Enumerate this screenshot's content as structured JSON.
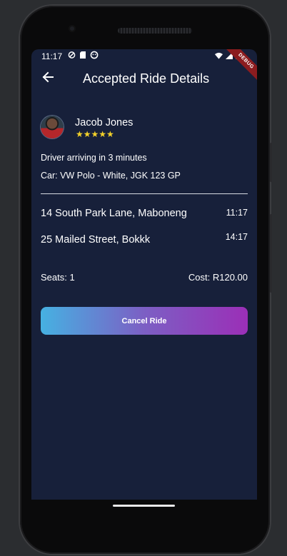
{
  "status_bar": {
    "time": "11:17"
  },
  "debug_banner": "DEBUG",
  "app_bar": {
    "title": "Accepted Ride Details"
  },
  "driver": {
    "name": "Jacob Jones",
    "rating_stars": "★★★★★",
    "rating": 5
  },
  "trip": {
    "arrival_text": "Driver arriving in 3 minutes",
    "car_text": "Car: VW Polo - White, JGK 123 GP",
    "pickup": {
      "address": "14 South Park Lane, Maboneng",
      "time": "11:17"
    },
    "dropoff": {
      "address": "25 Mailed Street, Bokkk",
      "time": "14:17"
    },
    "seats_text": "Seats: 1",
    "cost_text": "Cost: R120.00"
  },
  "actions": {
    "cancel_label": "Cancel Ride"
  },
  "colors": {
    "screen_bg": "#17203a",
    "star": "#f3d12a",
    "button_gradient_start": "#46b1e2",
    "button_gradient_end": "#9b2fb7"
  },
  "icons": {
    "back": "arrow-left-icon",
    "status": [
      "do-not-disturb-icon",
      "sd-card-icon",
      "android-icon",
      "wifi-icon",
      "signal-icon",
      "battery-icon"
    ]
  }
}
